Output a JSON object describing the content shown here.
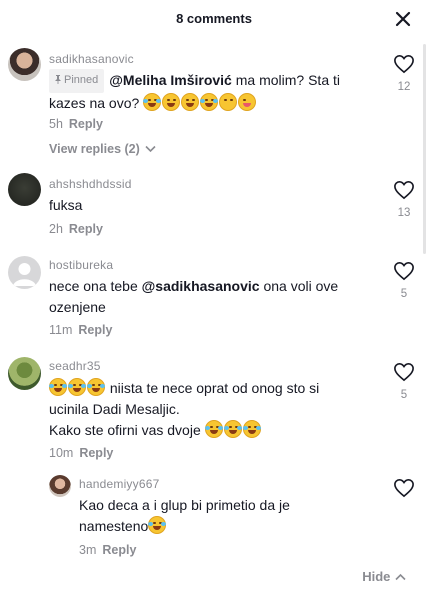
{
  "header": {
    "title": "8 comments"
  },
  "comments": [
    {
      "username": "sadikhasanovic",
      "pinned_label": "Pinned",
      "mention": "@Meliha Imširović",
      "text_line1": " ma molim? Sta ti",
      "text_line2": "kazes na ovo?",
      "time": "5h",
      "reply": "Reply",
      "likes": "12",
      "view_replies": "View replies (2)"
    },
    {
      "username": "ahshshdhdssid",
      "text": "fuksa",
      "time": "2h",
      "reply": "Reply",
      "likes": "13"
    },
    {
      "username": "hostibureka",
      "text_before": "nece ona tebe ",
      "mention": "@sadikhasanovic",
      "text_after": " ona voli ove",
      "text_line2": "ozenjene",
      "time": "11m",
      "reply": "Reply",
      "likes": "5"
    },
    {
      "username": "seadhr35",
      "text_line1": " niista te nece oprat od onog sto si",
      "text_line2": "ucinila Dadi Mesaljic.",
      "text_line3": "Kako ste ofirni vas dvoje ",
      "time": "10m",
      "reply": "Reply",
      "likes": "5"
    }
  ],
  "reply_comment": {
    "username": "handemiyy667",
    "text_line1": "Kao deca a i glup bi primetio da je",
    "text_line2": "namesteno",
    "time": "3m",
    "reply": "Reply"
  },
  "hide_label": "Hide",
  "colors": {
    "text": "#161823",
    "secondary": "#8a8b91",
    "background": "#ffffff"
  }
}
